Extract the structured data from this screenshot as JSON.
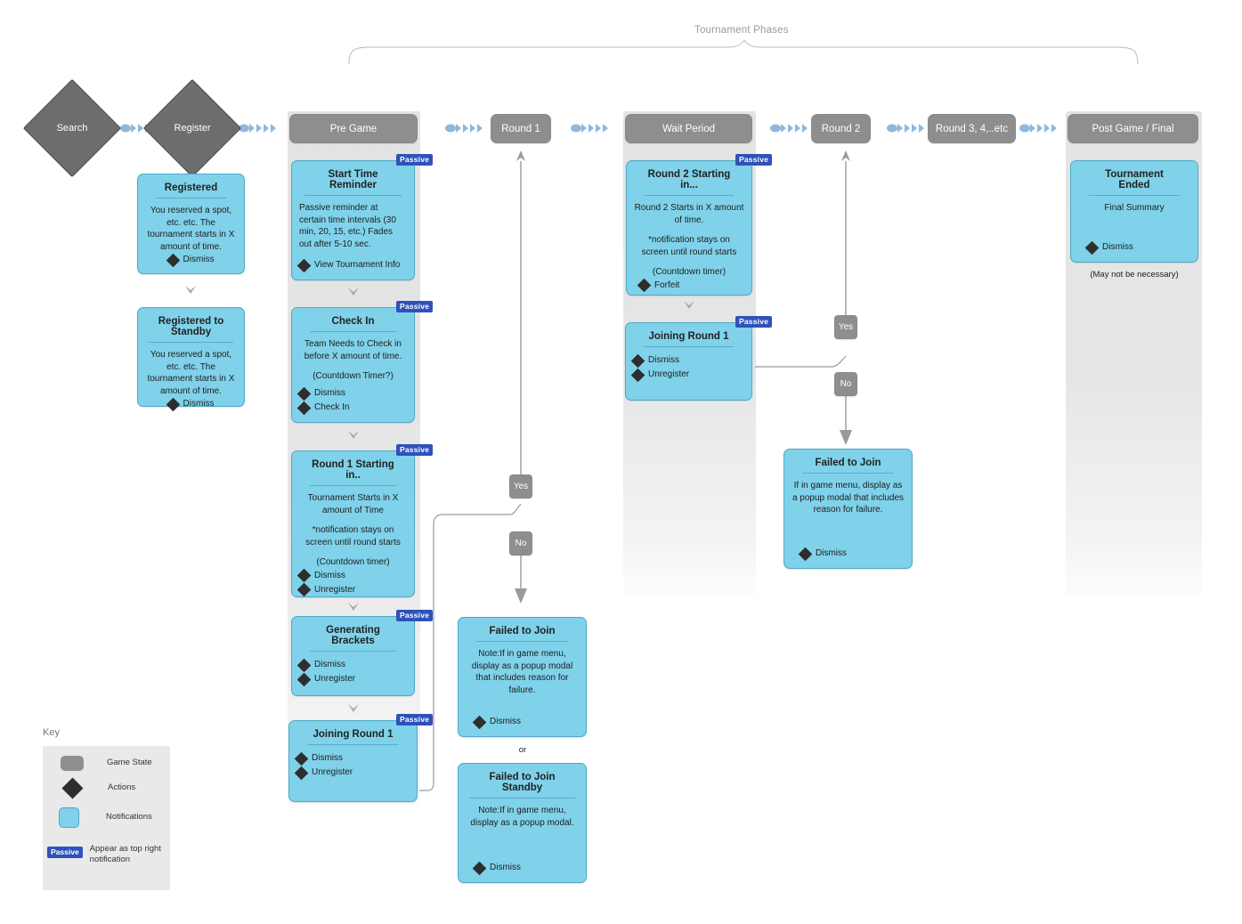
{
  "diagram": {
    "brace_label": "Tournament Phases"
  },
  "colors": {
    "state_gray": "#8e8e8e",
    "diamond_gray": "#6d6d6d",
    "notification_blue": "#7fd2ea",
    "notification_border": "#4fa9c6",
    "passive_badge": "#2f51b9",
    "lane_gray": "#e6e6e6",
    "connector_blue": "#8fb8dd",
    "connector_gray": "#9a9a9a"
  },
  "entry": {
    "search": "Search",
    "register": "Register"
  },
  "phases": [
    {
      "id": "pre-game",
      "label": "Pre Game"
    },
    {
      "id": "round-1",
      "label": "Round 1"
    },
    {
      "id": "wait-period",
      "label": "Wait Period"
    },
    {
      "id": "round-2",
      "label": "Round 2"
    },
    {
      "id": "round-3",
      "label": "Round 3, 4,..etc"
    },
    {
      "id": "post-game",
      "label": "Post Game / Final"
    }
  ],
  "notifications": {
    "registered": {
      "title": "Registered",
      "body": "You reserved a spot, etc. etc. The tournament starts in X amount of time.",
      "actions": [
        "Dismiss"
      ]
    },
    "registered_standby": {
      "title": "Registered to Standby",
      "body": "You reserved a spot, etc. etc. The tournament starts in X amount of time.",
      "actions": [
        "Dismiss"
      ]
    },
    "start_time_reminder": {
      "title": "Start Time Reminder",
      "badge": "Passive",
      "body": "Passive reminder at certain time intervals (30 min, 20, 15, etc.) Fades out after 5-10 sec.",
      "actions": [
        "View Tournament Info"
      ]
    },
    "check_in": {
      "title": "Check In",
      "badge": "Passive",
      "body_1": "Team Needs to Check in before X amount of time.",
      "body_2": "(Countdown Timer?)",
      "actions": [
        "Dismiss",
        "Check In"
      ]
    },
    "round_1_starting": {
      "title": "Round 1 Starting in..",
      "badge": "Passive",
      "body_1": "Tournament Starts in X amount of Time",
      "body_2": "*notification stays on screen until round starts",
      "body_3": "(Countdown timer)",
      "actions": [
        "Dismiss",
        "Unregister"
      ]
    },
    "generating_brackets": {
      "title": "Generating Brackets",
      "badge": "Passive",
      "actions": [
        "Dismiss",
        "Unregister"
      ]
    },
    "joining_round_1_pre": {
      "title": "Joining Round 1",
      "badge": "Passive",
      "actions": [
        "Dismiss",
        "Unregister"
      ]
    },
    "failed_to_join_r1": {
      "title": "Failed to Join",
      "body": "Note:If in game menu, display as a popup modal that includes reason for failure.",
      "actions": [
        "Dismiss"
      ]
    },
    "failed_to_join_standby": {
      "title": "Failed to Join Standby",
      "body": "Note:If in game menu, display as a popup modal.",
      "actions": [
        "Dismiss"
      ]
    },
    "round_2_starting": {
      "title": "Round 2 Starting in...",
      "badge": "Passive",
      "body_1": "Round 2 Starts in X amount of time.",
      "body_2": "*notification stays on screen until round starts",
      "body_3": "(Countdown timer)",
      "actions": [
        "Forfeit"
      ]
    },
    "joining_round_1_wait": {
      "title": "Joining Round 1",
      "badge": "Passive",
      "actions": [
        "Dismiss",
        "Unregister"
      ]
    },
    "failed_to_join_r2": {
      "title": "Failed to Join",
      "body": "If in game menu, display as a popup modal that includes reason for failure.",
      "actions": [
        "Dismiss"
      ]
    },
    "tournament_ended": {
      "title": "Tournament Ended",
      "body": "Final Summary",
      "actions": [
        "Dismiss"
      ],
      "footnote": "(May not be necessary)"
    }
  },
  "decisions": {
    "r1_yes": "Yes",
    "r1_no": "No",
    "r2_yes": "Yes",
    "r2_no": "No"
  },
  "labels": {
    "or": "or"
  },
  "key": {
    "title": "Key",
    "rows": [
      {
        "icon": "rounded-rect-gray",
        "label": "Game State"
      },
      {
        "icon": "diamond-dark",
        "label": "Actions"
      },
      {
        "icon": "rounded-rect-blue",
        "label": "Notifications"
      },
      {
        "icon": "passive-badge",
        "badge": "Passive",
        "label": "Appear as top right notification"
      }
    ]
  }
}
